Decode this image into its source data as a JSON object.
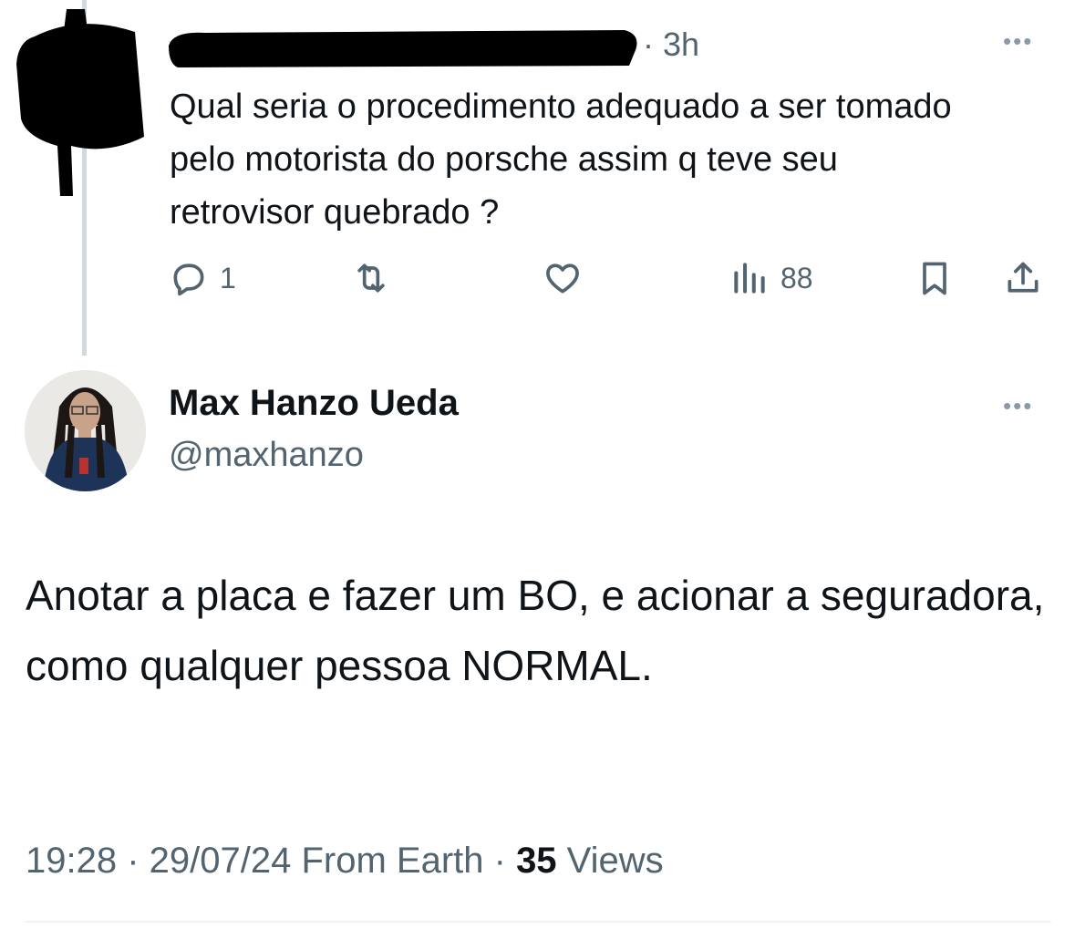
{
  "parent_tweet": {
    "time_ago": "· 3h",
    "more_icon": "ellipsis-icon",
    "text": "Qual seria o procedimento adequado a ser tomado pelo motorista do porsche assim q teve seu retrovisor quebrado ?",
    "actions": {
      "reply_count": "1",
      "retweet_count": "",
      "like_count": "",
      "views_count": "88"
    }
  },
  "reply_tweet": {
    "name": "Max Hanzo Ueda",
    "handle": "@maxhanzo",
    "text": "Anotar a placa e fazer um BO, e acionar a seguradora, como qualquer pessoa NORMAL.",
    "meta": {
      "time": "19:28",
      "sep1": " · ",
      "date": "29/07/24",
      "source": " From Earth",
      "sep2": " · ",
      "views_count": "35",
      "views_label": " Views"
    }
  },
  "colors": {
    "text": "#0f1419",
    "secondary": "#536471",
    "thread_line": "#cfd9de",
    "redaction": "#000000"
  }
}
